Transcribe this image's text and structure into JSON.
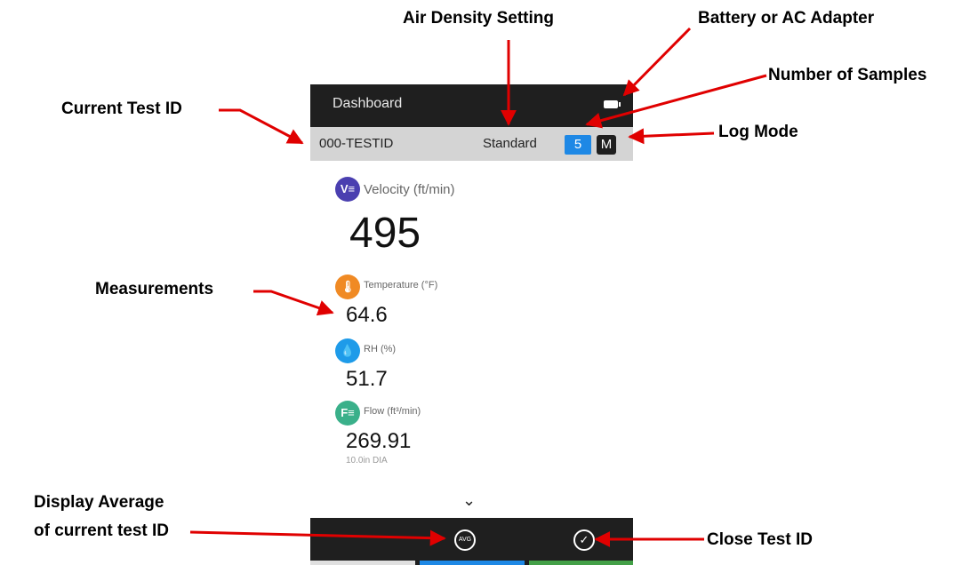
{
  "callouts": {
    "air_density_setting": "Air Density Setting",
    "battery_or_ac": "Battery or AC Adapter",
    "number_of_samples": "Number of Samples",
    "current_test_id": "Current Test ID",
    "log_mode": "Log Mode",
    "measurements": "Measurements",
    "display_average_line1": "Display Average",
    "display_average_line2": "of current test ID",
    "close_test_id": "Close Test ID"
  },
  "device": {
    "title": "Dashboard",
    "test_id": "000-TESTID",
    "density": "Standard",
    "samples": "5",
    "log_mode": "M",
    "measurements": [
      {
        "icon": "velocity-icon",
        "glyph": "V≡",
        "color": "#4a3fb0",
        "label": "Velocity (ft/min)",
        "value": "495"
      },
      {
        "icon": "thermometer-icon",
        "glyph": "🌡",
        "color": "#f08a24",
        "label": "Temperature (°F)",
        "value": "64.6"
      },
      {
        "icon": "droplet-icon",
        "glyph": "💧",
        "color": "#1e9be9",
        "label": "RH (%)",
        "value": "51.7"
      },
      {
        "icon": "flow-icon",
        "glyph": "F≡",
        "color": "#3ab08a",
        "label": "Flow (ft³/min)",
        "value": "269.91",
        "sub": "10.0in DIA"
      }
    ],
    "avg_glyph": "AVG",
    "close_glyph": "✓",
    "strip_colors": [
      "#e0e0e0",
      "#1e88e5",
      "#43a047"
    ]
  }
}
